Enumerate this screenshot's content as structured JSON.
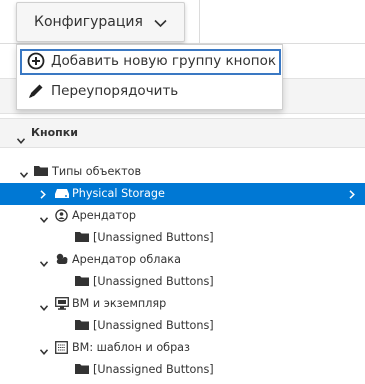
{
  "toolbar": {
    "config_label": "Конфигурация"
  },
  "menu": {
    "add_group": "Добавить новую группу кнопок",
    "reorder": "Переупорядочить"
  },
  "section": {
    "title": "Кнопки"
  },
  "tree": {
    "root": "Типы объектов",
    "nodes": [
      {
        "label": "Physical Storage",
        "child": ""
      },
      {
        "label": "Арендатор",
        "child": "[Unassigned Buttons]"
      },
      {
        "label": "Арендатор облака",
        "child": "[Unassigned Buttons]"
      },
      {
        "label": "ВМ и экземпляр",
        "child": "[Unassigned Buttons]"
      },
      {
        "label": "ВМ: шаблон и образ",
        "child": "[Unassigned Buttons]"
      }
    ]
  },
  "colors": {
    "selection": "#0078d4",
    "menu_focus_border": "#3a78c3"
  },
  "icons": [
    "chevron-down-icon",
    "plus-circle-icon",
    "pencil-icon",
    "caret-down-icon",
    "chevron-right-icon",
    "folder-icon",
    "storage-icon",
    "tenant-icon",
    "cloud-tenant-icon",
    "vm-icon",
    "template-icon"
  ]
}
